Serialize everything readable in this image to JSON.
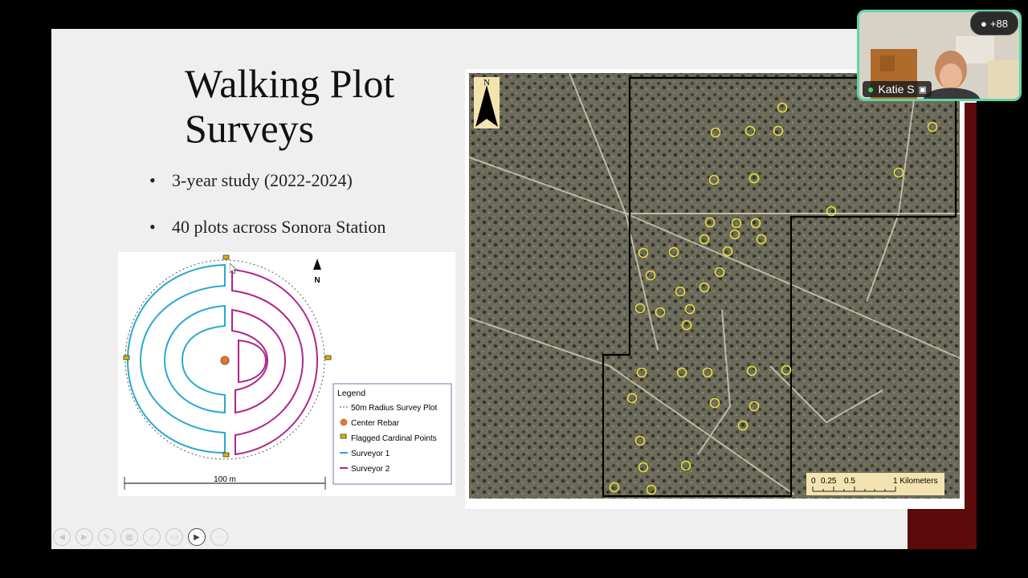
{
  "slide": {
    "title_line1": "Walking Plot",
    "title_line2": "Surveys",
    "bullets": [
      "3-year study (2022-2024)",
      "40 plots across Sonora Station"
    ]
  },
  "diagram": {
    "north_label": "N",
    "legend_title": "Legend",
    "legend_items": [
      "50m Radius Survey Plot",
      "Center Rebar",
      "Flagged Cardinal Points",
      "Surveyor 1",
      "Surveyor 2"
    ],
    "scale_label": "100 m",
    "colors": {
      "surveyor1": "#2aa8d0",
      "surveyor2": "#b0248a",
      "rebar": "#d9783a",
      "flag": "#e0b400"
    }
  },
  "map": {
    "north_label": "N",
    "scale_ticks": [
      "0",
      "0.25",
      "0.5",
      "1 Kilometers"
    ],
    "plot_marker_color": "#e8df3a"
  },
  "video": {
    "participant_name": "Katie S",
    "participant_count": "+88"
  },
  "controls": {
    "icons": [
      "prev-icon",
      "next-icon",
      "pen-icon",
      "grid-icon",
      "zoom-icon",
      "subtitles-icon",
      "camera-icon",
      "more-icon"
    ]
  }
}
